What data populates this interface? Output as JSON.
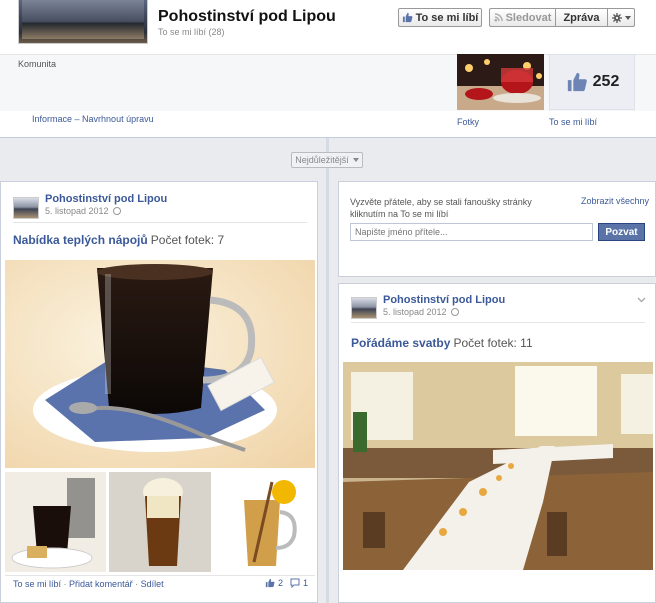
{
  "page": {
    "name": "Pohostinství pod Lipou",
    "likes_line": "To se mi líbí (28)",
    "category": "Komunita",
    "info_link": "Informace",
    "info_sep": " – ",
    "edit_link": "Navrhnout úpravu"
  },
  "actions": {
    "like": "To se mi líbí",
    "follow": "Sledovat",
    "message": "Zpráva",
    "gear_icon": "gear-icon"
  },
  "tiles": {
    "photos_label": "Fotky",
    "likes_count": "252",
    "likes_label": "To se mi líbí"
  },
  "timeline": {
    "sort_label": "Nejdůležitější"
  },
  "invite": {
    "text": "Vyzvěte přátele, aby se stali fanoušky stránky kliknutím na To se mi líbí",
    "show_all": "Zobrazit všechny",
    "placeholder": "Napište jméno přítele...",
    "button": "Pozvat"
  },
  "posts": [
    {
      "author": "Pohostinství pod Lipou",
      "date": "5. listopad 2012",
      "album_title": "Nabídka teplých nápojů",
      "album_count": "Počet fotek: 7",
      "footer": {
        "like": "To se mi líbí",
        "comment": "Přidat komentář",
        "share": "Sdílet",
        "like_count": "2",
        "comment_count": "1"
      }
    },
    {
      "author": "Pohostinství pod Lipou",
      "date": "5. listopad 2012",
      "album_title": "Pořádáme svatby",
      "album_count": "Počet fotek: 11"
    }
  ],
  "colors": {
    "link": "#3b5998",
    "button_blue": "#5b74a8",
    "background": "#e9ebee"
  }
}
